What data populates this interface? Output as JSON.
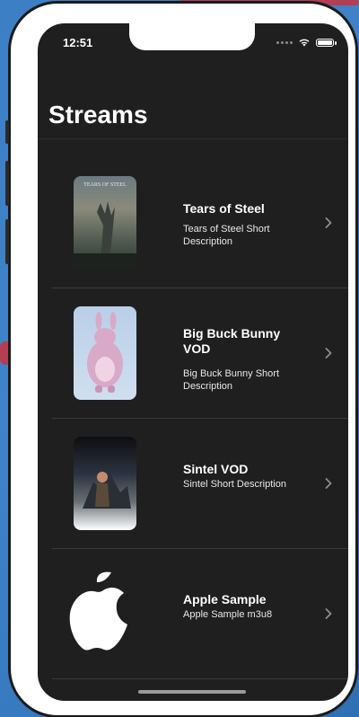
{
  "status_bar": {
    "time": "12:51"
  },
  "nav": {
    "title": "Streams"
  },
  "streams": [
    {
      "title": "Tears of Steel",
      "subtitle": "Tears of Steel Short Description",
      "thumbnail": "tears-of-steel-poster",
      "poster_text": "TEARS OF STEEL"
    },
    {
      "title": "Big Buck Bunny VOD",
      "subtitle": "Big Buck Bunny Short Description",
      "thumbnail": "big-buck-bunny-poster"
    },
    {
      "title": "Sintel VOD",
      "subtitle": "Sintel Short Description",
      "thumbnail": "sintel-poster"
    },
    {
      "title": "Apple Sample",
      "subtitle": "Apple Sample m3u8",
      "thumbnail": "apple-logo"
    }
  ],
  "colors": {
    "screen_bg": "#1f1f1f",
    "text": "#ffffff",
    "chevron": "#8e8e93",
    "divider": "#3a3a3a"
  },
  "icons": {
    "chevron": "chevron-right-icon",
    "wifi": "wifi-icon",
    "battery": "battery-icon",
    "signal": "signal-icon"
  }
}
